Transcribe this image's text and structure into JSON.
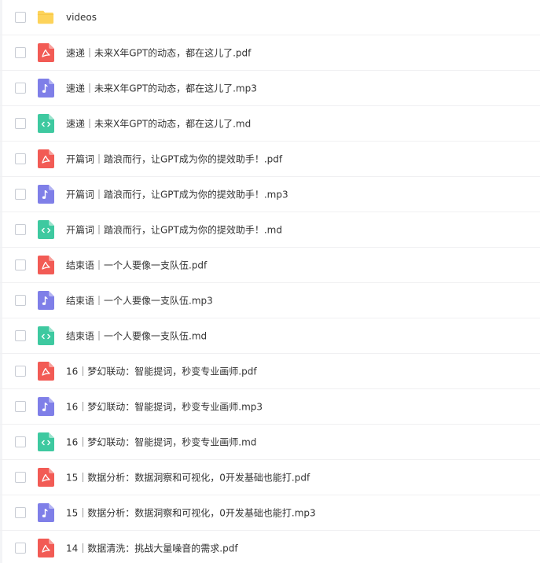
{
  "files": [
    {
      "name": "videos",
      "type": "folder",
      "icon": "folder-icon"
    },
    {
      "name": "速递｜未来X年GPT的动态，都在这儿了.pdf",
      "type": "pdf",
      "icon": "pdf-icon"
    },
    {
      "name": "速递｜未来X年GPT的动态，都在这儿了.mp3",
      "type": "mp3",
      "icon": "music-note-icon"
    },
    {
      "name": "速递｜未来X年GPT的动态，都在这儿了.md",
      "type": "md",
      "icon": "code-icon"
    },
    {
      "name": "开篇词｜踏浪而行，让GPT成为你的提效助手！.pdf",
      "type": "pdf",
      "icon": "pdf-icon"
    },
    {
      "name": "开篇词｜踏浪而行，让GPT成为你的提效助手！.mp3",
      "type": "mp3",
      "icon": "music-note-icon"
    },
    {
      "name": "开篇词｜踏浪而行，让GPT成为你的提效助手！.md",
      "type": "md",
      "icon": "code-icon"
    },
    {
      "name": "结束语｜一个人要像一支队伍.pdf",
      "type": "pdf",
      "icon": "pdf-icon"
    },
    {
      "name": "结束语｜一个人要像一支队伍.mp3",
      "type": "mp3",
      "icon": "music-note-icon"
    },
    {
      "name": "结束语｜一个人要像一支队伍.md",
      "type": "md",
      "icon": "code-icon"
    },
    {
      "name": "16｜梦幻联动：智能提词，秒变专业画师.pdf",
      "type": "pdf",
      "icon": "pdf-icon"
    },
    {
      "name": "16｜梦幻联动：智能提词，秒变专业画师.mp3",
      "type": "mp3",
      "icon": "music-note-icon"
    },
    {
      "name": "16｜梦幻联动：智能提词，秒变专业画师.md",
      "type": "md",
      "icon": "code-icon"
    },
    {
      "name": "15｜数据分析：数据洞察和可视化，0开发基础也能打.pdf",
      "type": "pdf",
      "icon": "pdf-icon"
    },
    {
      "name": "15｜数据分析：数据洞察和可视化，0开发基础也能打.mp3",
      "type": "mp3",
      "icon": "music-note-icon"
    },
    {
      "name": "14｜数据清洗：挑战大量噪音的需求.pdf",
      "type": "pdf",
      "icon": "pdf-icon"
    }
  ],
  "colors": {
    "folder": "#fdd35a",
    "pdf": "#f25b55",
    "mp3": "#7f7fe8",
    "md": "#3ec9a0"
  }
}
